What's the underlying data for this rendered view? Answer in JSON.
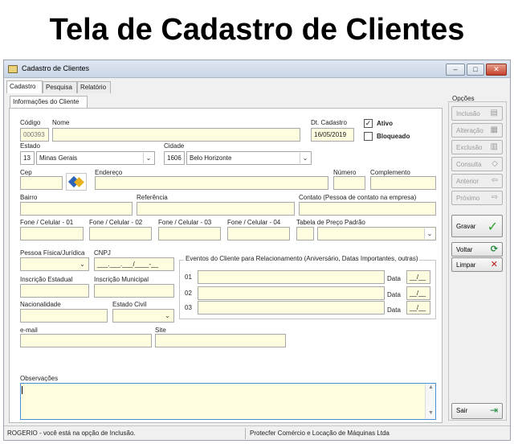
{
  "page_heading": "Tela de Cadastro de Clientes",
  "window": {
    "title": "Cadastro de Clientes",
    "controls": {
      "minimize": "–",
      "maximize": "□",
      "close": "✕"
    }
  },
  "tabs": [
    "Cadastro",
    "Pesquisa",
    "Relatório"
  ],
  "subtab": "Informações do Cliente",
  "form": {
    "codigo": {
      "label": "Código",
      "value": "000393"
    },
    "nome": {
      "label": "Nome",
      "value": ""
    },
    "dt_cadastro": {
      "label": "Dt. Cadastro",
      "value": "16/05/2019"
    },
    "ativo": {
      "label": "Ativo",
      "checked": true
    },
    "bloqueado": {
      "label": "Bloqueado",
      "checked": false
    },
    "estado": {
      "label": "Estado",
      "code": "13",
      "name": "Minas Gerais"
    },
    "cidade": {
      "label": "Cidade",
      "code": "1606",
      "name": "Belo Horizonte"
    },
    "cep": {
      "label": "Cep",
      "value": ""
    },
    "endereco": {
      "label": "Endereço",
      "value": ""
    },
    "numero": {
      "label": "Número",
      "value": ""
    },
    "complemento": {
      "label": "Complemento",
      "value": ""
    },
    "bairro": {
      "label": "Bairro",
      "value": ""
    },
    "referencia": {
      "label": "Referência",
      "value": ""
    },
    "contato": {
      "label": "Contato (Pessoa de contato na empresa)",
      "value": ""
    },
    "fone1": {
      "label": "Fone / Celular - 01",
      "value": ""
    },
    "fone2": {
      "label": "Fone / Celular - 02",
      "value": ""
    },
    "fone3": {
      "label": "Fone / Celular - 03",
      "value": ""
    },
    "fone4": {
      "label": "Fone / Celular - 04",
      "value": ""
    },
    "tabela_preco": {
      "label": "Tabela de Preço Padrão",
      "value": ""
    },
    "pessoa": {
      "label": "Pessoa Física/Jurídica",
      "value": ""
    },
    "cnpj": {
      "label": "CNPJ",
      "value": "___.___.___/____-__"
    },
    "inscricao_estadual": {
      "label": "Inscrição Estadual",
      "value": ""
    },
    "inscricao_municipal": {
      "label": "Inscrição Municipal",
      "value": ""
    },
    "nacionalidade": {
      "label": "Nacionalidade",
      "value": ""
    },
    "estado_civil": {
      "label": "Estado Civil",
      "value": ""
    },
    "email": {
      "label": "e-mail",
      "value": ""
    },
    "site": {
      "label": "Site",
      "value": ""
    },
    "observacoes": {
      "label": "Observações",
      "value": ""
    }
  },
  "eventos": {
    "title": "Eventos do Cliente para Relacionamento (Aniversário, Datas Importantes, outras)",
    "rows": [
      {
        "num": "01",
        "data_label": "Data",
        "date": "__/__"
      },
      {
        "num": "02",
        "data_label": "Data",
        "date": "__/__"
      },
      {
        "num": "03",
        "data_label": "Data",
        "date": "__/__"
      }
    ]
  },
  "opcoes": {
    "title": "Opções",
    "buttons": [
      {
        "label": "Inclusão",
        "accel": "I",
        "icon": "add-record-icon",
        "enabled": false
      },
      {
        "label": "Alteração",
        "accel": "A",
        "icon": "edit-record-icon",
        "enabled": false
      },
      {
        "label": "Exclusão",
        "accel": "E",
        "icon": "delete-record-icon",
        "enabled": false
      },
      {
        "label": "Consulta",
        "accel": "",
        "icon": "search-icon",
        "enabled": false
      },
      {
        "label": "Anterior",
        "accel": "",
        "icon": "previous-icon",
        "enabled": false
      },
      {
        "label": "Próximo",
        "accel": "",
        "icon": "next-icon",
        "enabled": false
      }
    ],
    "gravar": "Gravar",
    "voltar": "Voltar",
    "limpar": "Limpar",
    "sair": "Sair"
  },
  "status": {
    "left": "ROGERIO - você está na opção de Inclusão.",
    "right": "Protecfer Comércio e Locação de Máquinas Ltda"
  },
  "colors": {
    "field_bg": "#fffde0",
    "gravar_check": "#2e9b2e",
    "limpar_x": "#c01818",
    "voltar_arrow": "#1f8a3a"
  }
}
